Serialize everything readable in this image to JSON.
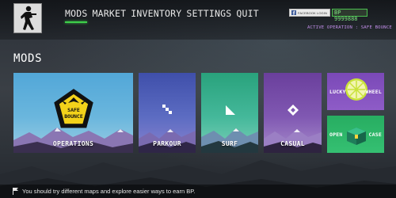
{
  "nav": {
    "items": [
      {
        "label": "MODS"
      },
      {
        "label": "MARKET"
      },
      {
        "label": "INVENTORY"
      },
      {
        "label": "SETTINGS"
      },
      {
        "label": "QUIT"
      }
    ],
    "active": "MODS"
  },
  "account": {
    "facebook_label": "FACEBOOK LOGIN",
    "bp_value": "BP 9999888"
  },
  "active_operation": "ACTIVE OPERATION : SAFE BOUNCE",
  "section_title": "MODS",
  "cards": {
    "operations": {
      "label": "OPERATIONS",
      "badge_line1": "SAFE",
      "badge_line2": "BOUNCE"
    },
    "parkour": {
      "label": "PARKOUR"
    },
    "surf": {
      "label": "SURF"
    },
    "casual": {
      "label": "CASUAL"
    },
    "lucky_wheel": {
      "label_left": "LUCKY",
      "label_right": "WHEEL"
    },
    "open_case": {
      "label_left": "OPEN",
      "label_right": "CASE"
    }
  },
  "footer": {
    "tip": "You should try different maps and explore easier ways to earn BP."
  },
  "colors": {
    "accent_green": "#3ecf4a",
    "operation_purple": "#c18de8",
    "operations_blue": "#52a7d8",
    "parkour_indigo": "#3f4faa",
    "surf_teal": "#29a27c",
    "casual_purple": "#6a3f9c",
    "lucky_purple": "#7a49b7",
    "case_green": "#27ad61"
  },
  "icons": {
    "avatar": "soldier-running-icon",
    "facebook": "facebook-icon",
    "operations": "winged-pentagon-badge-icon",
    "parkour": "stairs-icon",
    "surf": "triangle-ramp-icon",
    "casual": "diamond-cross-icon",
    "lucky_wheel": "lemon-wheel-icon",
    "open_case": "case-box-icon",
    "tip": "flag-icon"
  }
}
